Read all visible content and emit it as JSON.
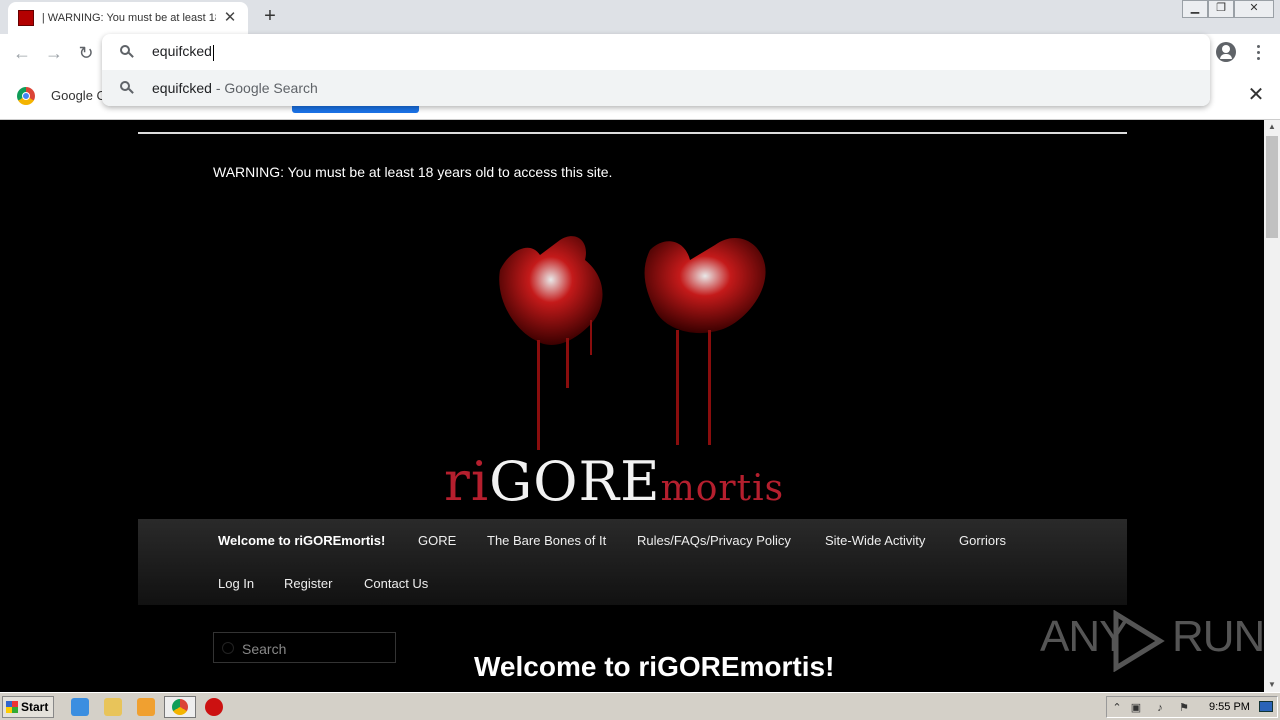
{
  "browser": {
    "tab_title": "| WARNING: You must be at least 18",
    "omnibox_value": "equifcked",
    "suggestion_query": "equifcked",
    "suggestion_suffix": " - Google Search",
    "infobar_text": "Google Cl"
  },
  "page": {
    "warning": "WARNING: You must be at least 18 years old to access this site.",
    "logo_ri": "ri",
    "logo_gore": "GORE",
    "logo_mortis": "mortis",
    "nav_row1": [
      "Welcome to riGOREmortis!",
      "GORE",
      "The Bare Bones of It",
      "Rules/FAQs/Privacy Policy",
      "Site-Wide Activity",
      "Gorriors"
    ],
    "nav_row2": [
      "Log In",
      "Register",
      "Contact Us"
    ],
    "search_placeholder": "Search",
    "heading": "Welcome to riGOREmortis!"
  },
  "watermark": {
    "left": "ANY",
    "right": "RUN"
  },
  "taskbar": {
    "start_label": "Start",
    "clock": "9:55 PM"
  },
  "colors": {
    "accent_red": "#b51f2e",
    "chrome_blue": "#1a73e8"
  }
}
